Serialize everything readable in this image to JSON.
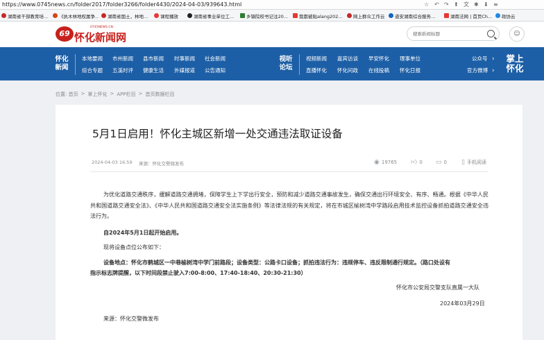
{
  "browser": {
    "url": "https://www.0745news.cn/folder2017/folder3266/folder4430/2024-04-03/939643.html",
    "bookmarks": [
      "湖南省干部教育培...",
      "《执木林地权属争...",
      "湖南省国土，林地...",
      "课程播放",
      "湖南省事业单位工...",
      "乡镇院校书记注20...",
      "我都被贴alang202...",
      "网上群众工作云",
      "道安湖南综合服务...",
      "湖南法网 | 首页Ch...",
      "政协云"
    ]
  },
  "site": {
    "logo_mark": "69",
    "logo_text": "怀化新闻网",
    "logo_sub": "0745NEWS.CN",
    "search_placeholder": "搜索新闻标题"
  },
  "nav": {
    "section1": "怀化新闻",
    "row1": [
      "本地要闻",
      "市州新闻",
      "县市新闻",
      "时事新闻",
      "社会新闻"
    ],
    "row2": [
      "综合专题",
      "五溪时评",
      "健康生活",
      "外媒报道",
      "公告通知"
    ],
    "section2": "视听论坛",
    "row3": [
      "视频新闻",
      "嘉宾访谈",
      "早安怀化",
      "理事单位"
    ],
    "row4": [
      "直播怀化",
      "怀化问政",
      "在线投稿",
      "怀化日报"
    ],
    "right1": "公众号",
    "right2": "官方微博",
    "zhang": "掌上怀化"
  },
  "breadcrumb": [
    "位置: 首页",
    ">",
    "掌上怀化",
    ">",
    "APP栏目",
    ">",
    "首页数据栏目"
  ],
  "article": {
    "title": "5月1日启用！怀化主城区新增一处交通违法取证设备",
    "date": "2024-04-03 16:59",
    "source": "来源：怀化交警微发布",
    "views": "19765",
    "likes": "0",
    "comments": "0",
    "mobile": "手机阅读",
    "p1": "为优化道路交通秩序，缓解道路交通拥堵，保障学生上下学出行安全，预防和减少道路交通事故发生，确保交通出行环境安全、有序、畅通。根据《中华人民共和国道路交通安全法》、《中华人民共和国道路交通安全法实施条例》等法律法规的有关规定，将在市城区榆树湾中学路段启用技术监控设备抓拍道路交通安全违法行为。",
    "p2": "自2024年5月1日起开始启用。",
    "p3": "现将设备点位公布如下：",
    "p4a": "设备地点：怀化市鹤城区一中巷榆树湾中学门前路段；设备类型：公路卡口设备；抓拍违法行为：违规停车、违反限制通行规定。（路口处设有",
    "p4b": "指示标志牌提醒，以下时间段禁止驶入7:00-8:00、17:40-18:40、20:30-21:30）",
    "sign_org": "怀化市公安局交警支队直属一大队",
    "sign_date": "2024年03月29日",
    "footer_source": "来源：怀化交警微发布"
  },
  "colors": {
    "nav_blue": "#1d5fa6",
    "brand_red": "#c8201c"
  }
}
